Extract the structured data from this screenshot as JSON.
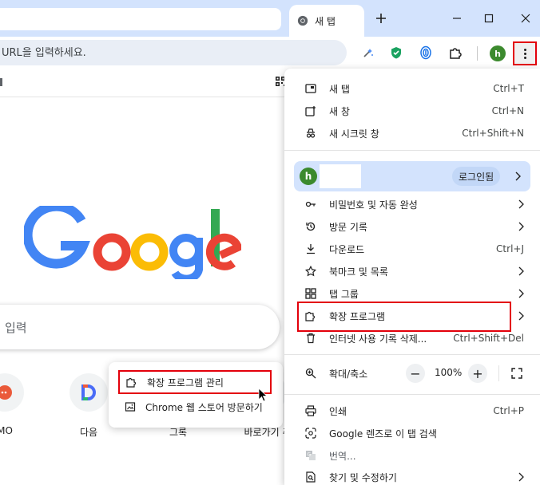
{
  "tab": {
    "title": "새 탭"
  },
  "omnibox": {
    "placeholder": "URL을 입력하세요."
  },
  "avatar": {
    "initial": "h"
  },
  "google": {
    "search_placeholder": "입력",
    "logo_colors": {
      "blue": "#4285F4",
      "red": "#EA4335",
      "yellow": "#FBBC05",
      "green": "#34A853"
    }
  },
  "shortcuts": [
    {
      "label": "MO",
      "icon": "red-circle-icon"
    },
    {
      "label": "다음",
      "icon": "daum-icon"
    },
    {
      "label": "그록",
      "icon": "grok-icon"
    },
    {
      "label": "바로가기 추",
      "icon": "plus-icon"
    }
  ],
  "submenu": {
    "items": [
      {
        "label": "확장 프로그램 관리"
      },
      {
        "label": "Chrome 웹 스토어 방문하기"
      }
    ]
  },
  "menu": {
    "new_tab": {
      "label": "새 탭",
      "shortcut": "Ctrl+T"
    },
    "new_window": {
      "label": "새 창",
      "shortcut": "Ctrl+N"
    },
    "incognito": {
      "label": "새 시크릿 창",
      "shortcut": "Ctrl+Shift+N"
    },
    "profile": {
      "initial": "h",
      "badge": "로그인됨"
    },
    "passwords": {
      "label": "비밀번호 및 자동 완성"
    },
    "history": {
      "label": "방문 기록"
    },
    "downloads": {
      "label": "다운로드",
      "shortcut": "Ctrl+J"
    },
    "bookmarks": {
      "label": "북마크 및 목록"
    },
    "tab_groups": {
      "label": "탭 그룹"
    },
    "extensions": {
      "label": "확장 프로그램"
    },
    "clear_data": {
      "label": "인터넷 사용 기록 삭제...",
      "shortcut": "Ctrl+Shift+Del"
    },
    "zoom": {
      "label": "확대/축소",
      "minus": "−",
      "value": "100%",
      "plus": "+"
    },
    "print": {
      "label": "인쇄",
      "shortcut": "Ctrl+P"
    },
    "lens": {
      "label": "Google 렌즈로 이 탭 검색"
    },
    "translate": {
      "label": "번역..."
    },
    "find_edit": {
      "label": "찾기 및 수정하기"
    }
  },
  "colors": {
    "highlight_red": "#E3000B",
    "tabstrip": "#D3E3FD",
    "profile_green": "#3C8A2E"
  }
}
